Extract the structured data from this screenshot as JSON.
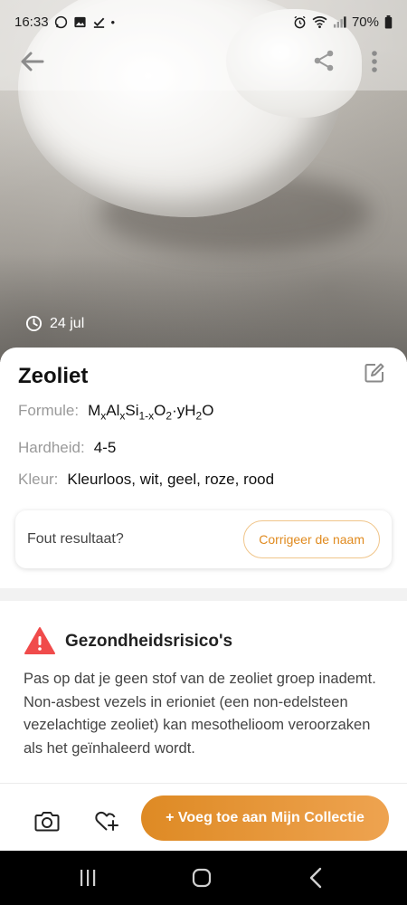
{
  "status_bar": {
    "time": "16:33",
    "battery": "70%"
  },
  "photo": {
    "date": "24 jul"
  },
  "mineral": {
    "name": "Zeoliet",
    "formula_label": "Formule:",
    "formula_parts": [
      "M",
      "x",
      "Al",
      "x",
      "Si",
      "1-x",
      "O",
      "2",
      "·yH",
      "2",
      "O"
    ],
    "hardness_label": "Hardheid:",
    "hardness_value": "4-5",
    "color_label": "Kleur:",
    "color_value": "Kleurloos, wit, geel, roze, rood"
  },
  "feedback": {
    "question": "Fout resultaat?",
    "button": "Corrigeer de naam"
  },
  "health": {
    "title": "Gezondheidsrisico's",
    "text": "Pas op dat je geen stof van de zeoliet groep inademt. Non-asbest vezels in erioniet (een non-edelsteen vezelachtige zeoliet) kan mesothelioom veroorzaken als het geïnhaleerd wordt."
  },
  "actions": {
    "add_button": "+ Voeg toe aan Mijn Collectie"
  },
  "colors": {
    "accent": "#e08a1e",
    "warning": "#f04b4b"
  },
  "icons": [
    "back-arrow-icon",
    "share-icon",
    "more-vertical-icon",
    "clock-icon",
    "edit-icon",
    "warning-icon",
    "camera-icon",
    "heart-plus-icon"
  ]
}
